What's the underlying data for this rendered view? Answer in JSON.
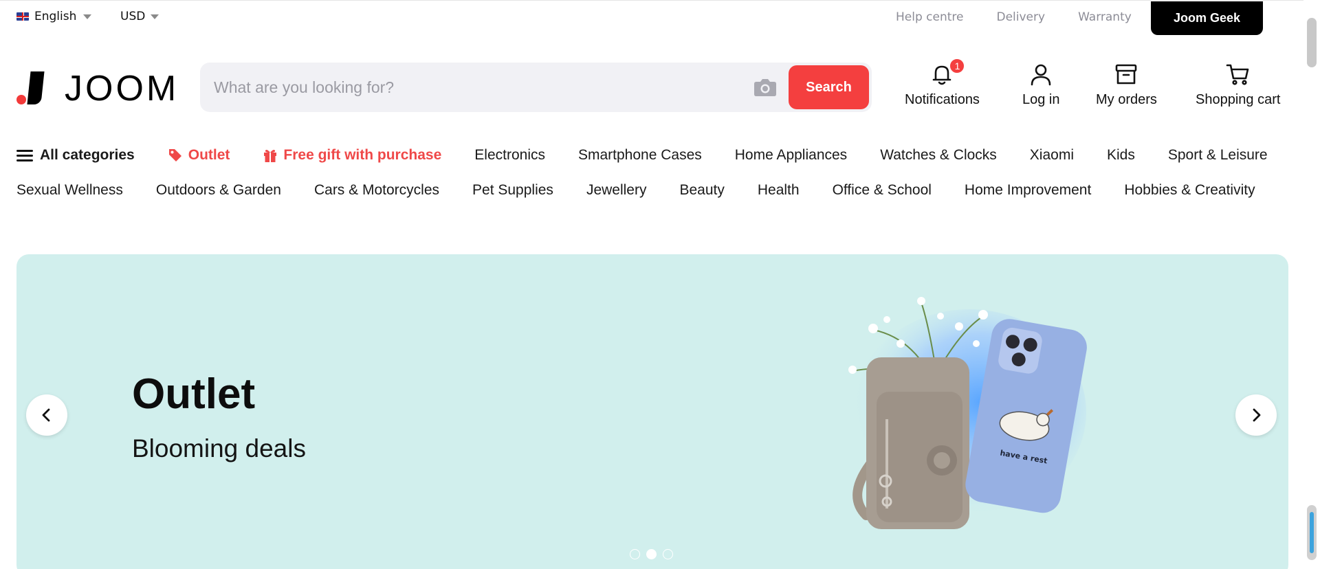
{
  "topbar": {
    "language": "English",
    "currency": "USD",
    "links": [
      "Help centre",
      "Delivery",
      "Warranty"
    ],
    "geek_label": "Joom Geek"
  },
  "header": {
    "logo_text": "JOOM",
    "search_placeholder": "What are you looking for?",
    "search_button": "Search",
    "notifications_label": "Notifications",
    "notifications_count": "1",
    "login_label": "Log in",
    "orders_label": "My orders",
    "cart_label": "Shopping cart"
  },
  "categories": {
    "all_label": "All categories",
    "promos": [
      "Outlet",
      "Free gift with purchase"
    ],
    "row1": [
      "Electronics",
      "Smartphone Cases",
      "Home Appliances",
      "Watches & Clocks",
      "Xiaomi",
      "Kids",
      "Sport & Leisure"
    ],
    "row2": [
      "Sexual Wellness",
      "Outdoors & Garden",
      "Cars & Motorcycles",
      "Pet Supplies",
      "Jewellery",
      "Beauty",
      "Health",
      "Office & School",
      "Home Improvement",
      "Hobbies & Creativity"
    ]
  },
  "banner": {
    "title": "Outlet",
    "subtitle": "Blooming deals",
    "phone_case_text": "have a rest",
    "slides": 3,
    "active_slide": 2,
    "background": "#d1efed"
  },
  "colors": {
    "accent": "#f43f3f",
    "promo_text": "#ef4848",
    "muted_text": "#8c8c96"
  }
}
